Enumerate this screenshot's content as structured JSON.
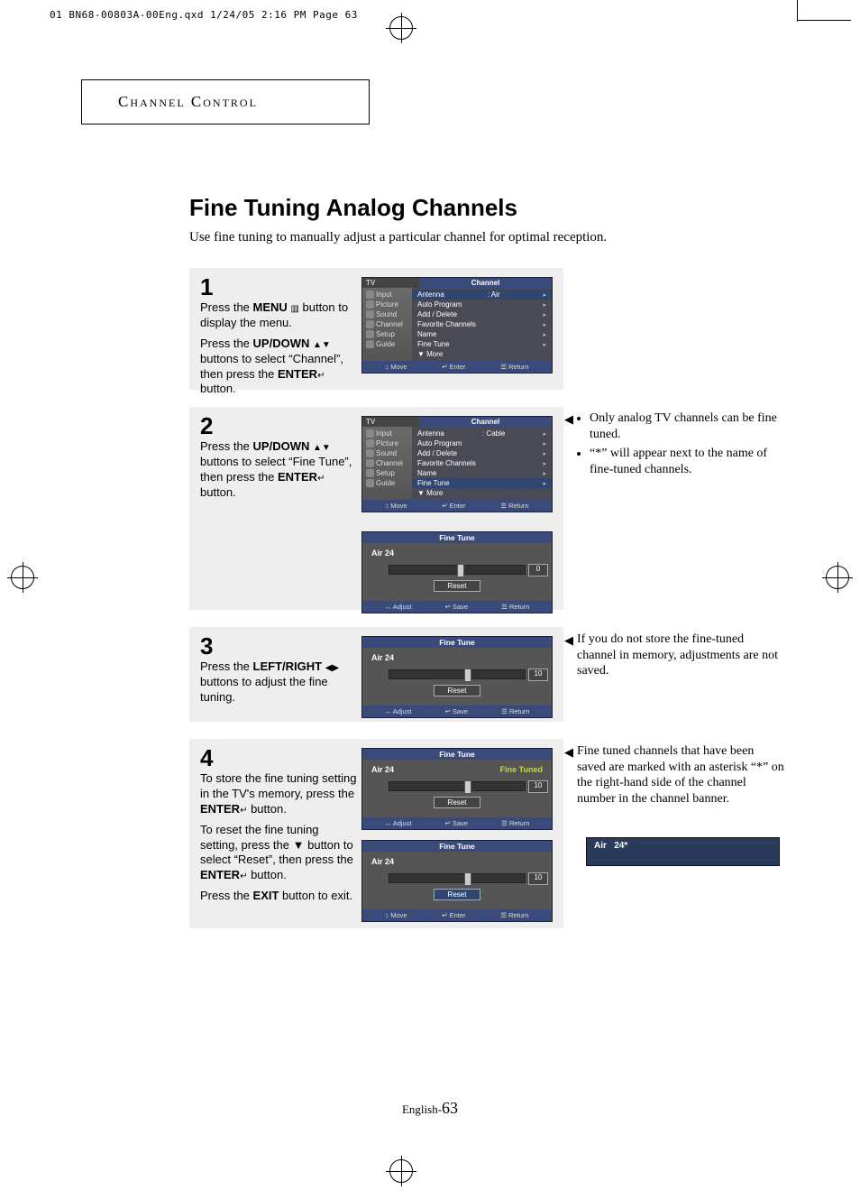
{
  "print_header": "01 BN68-00803A-00Eng.qxd  1/24/05 2:16 PM  Page 63",
  "section_title": "Channel Control",
  "page_title": "Fine Tuning Analog Channels",
  "intro": "Use fine tuning to manually adjust a particular channel for optimal reception.",
  "steps": {
    "s1": {
      "num": "1",
      "p1a": "Press the ",
      "p1b": "MENU",
      "p1c": " button to display the menu.",
      "p2a": "Press the ",
      "p2b": "UP/DOWN",
      "p2c": " buttons to select “Channel”, then press the ",
      "p2d": "ENTER",
      "p2e": " button."
    },
    "s2": {
      "num": "2",
      "p1a": "Press the ",
      "p1b": "UP/DOWN",
      "p1c": " buttons to select “Fine Tune”, then press the ",
      "p1d": "ENTER",
      "p1e": " button."
    },
    "s3": {
      "num": "3",
      "p1a": "Press the ",
      "p1b": "LEFT/RIGHT",
      "p1c": " buttons to adjust the fine tuning."
    },
    "s4": {
      "num": "4",
      "p1a": "To store the fine tuning setting in the TV's memory, press the ",
      "p1b": "ENTER",
      "p1c": " button.",
      "p2a": "To reset the fine tuning setting, press the ",
      "p2b": "▼",
      "p2c": " button to select “Reset”, then press the ",
      "p2d": "ENTER",
      "p2e": " button.",
      "p3a": "Press the ",
      "p3b": "EXIT",
      "p3c": " button to exit."
    }
  },
  "notes": {
    "n2a": "Only analog TV channels can be fine tuned.",
    "n2b": "“*” will appear next to the name of fine-tuned channels.",
    "n3": "If you do not store the fine-tuned channel in memory, adjustments are not saved.",
    "n4": "Fine tuned channels that have been saved are marked with an asterisk “*” on the right-hand side of the channel number in the channel banner."
  },
  "osd": {
    "tv": "TV",
    "channel": "Channel",
    "menu": [
      "Input",
      "Picture",
      "Sound",
      "Channel",
      "Setup",
      "Guide"
    ],
    "items": [
      "Antenna",
      "Auto Program",
      "Add / Delete",
      "Favorite Channels",
      "Name",
      "Fine Tune",
      "▼ More"
    ],
    "ant_air": ": Air",
    "ant_cable": ": Cable",
    "footer_move": "↕ Move",
    "footer_enter": "↵ Enter",
    "footer_return": "☰ Return",
    "footer_adjust": "↔ Adjust",
    "footer_save": "↵ Save",
    "ft_title": "Fine Tune",
    "ft_channel": "Air 24",
    "ft_tuned": "Fine Tuned",
    "reset": "Reset",
    "v0": "0",
    "v10": "10"
  },
  "banner": {
    "air": "Air",
    "ch": "24*"
  },
  "footer": {
    "lang": "English-",
    "page": "63"
  }
}
